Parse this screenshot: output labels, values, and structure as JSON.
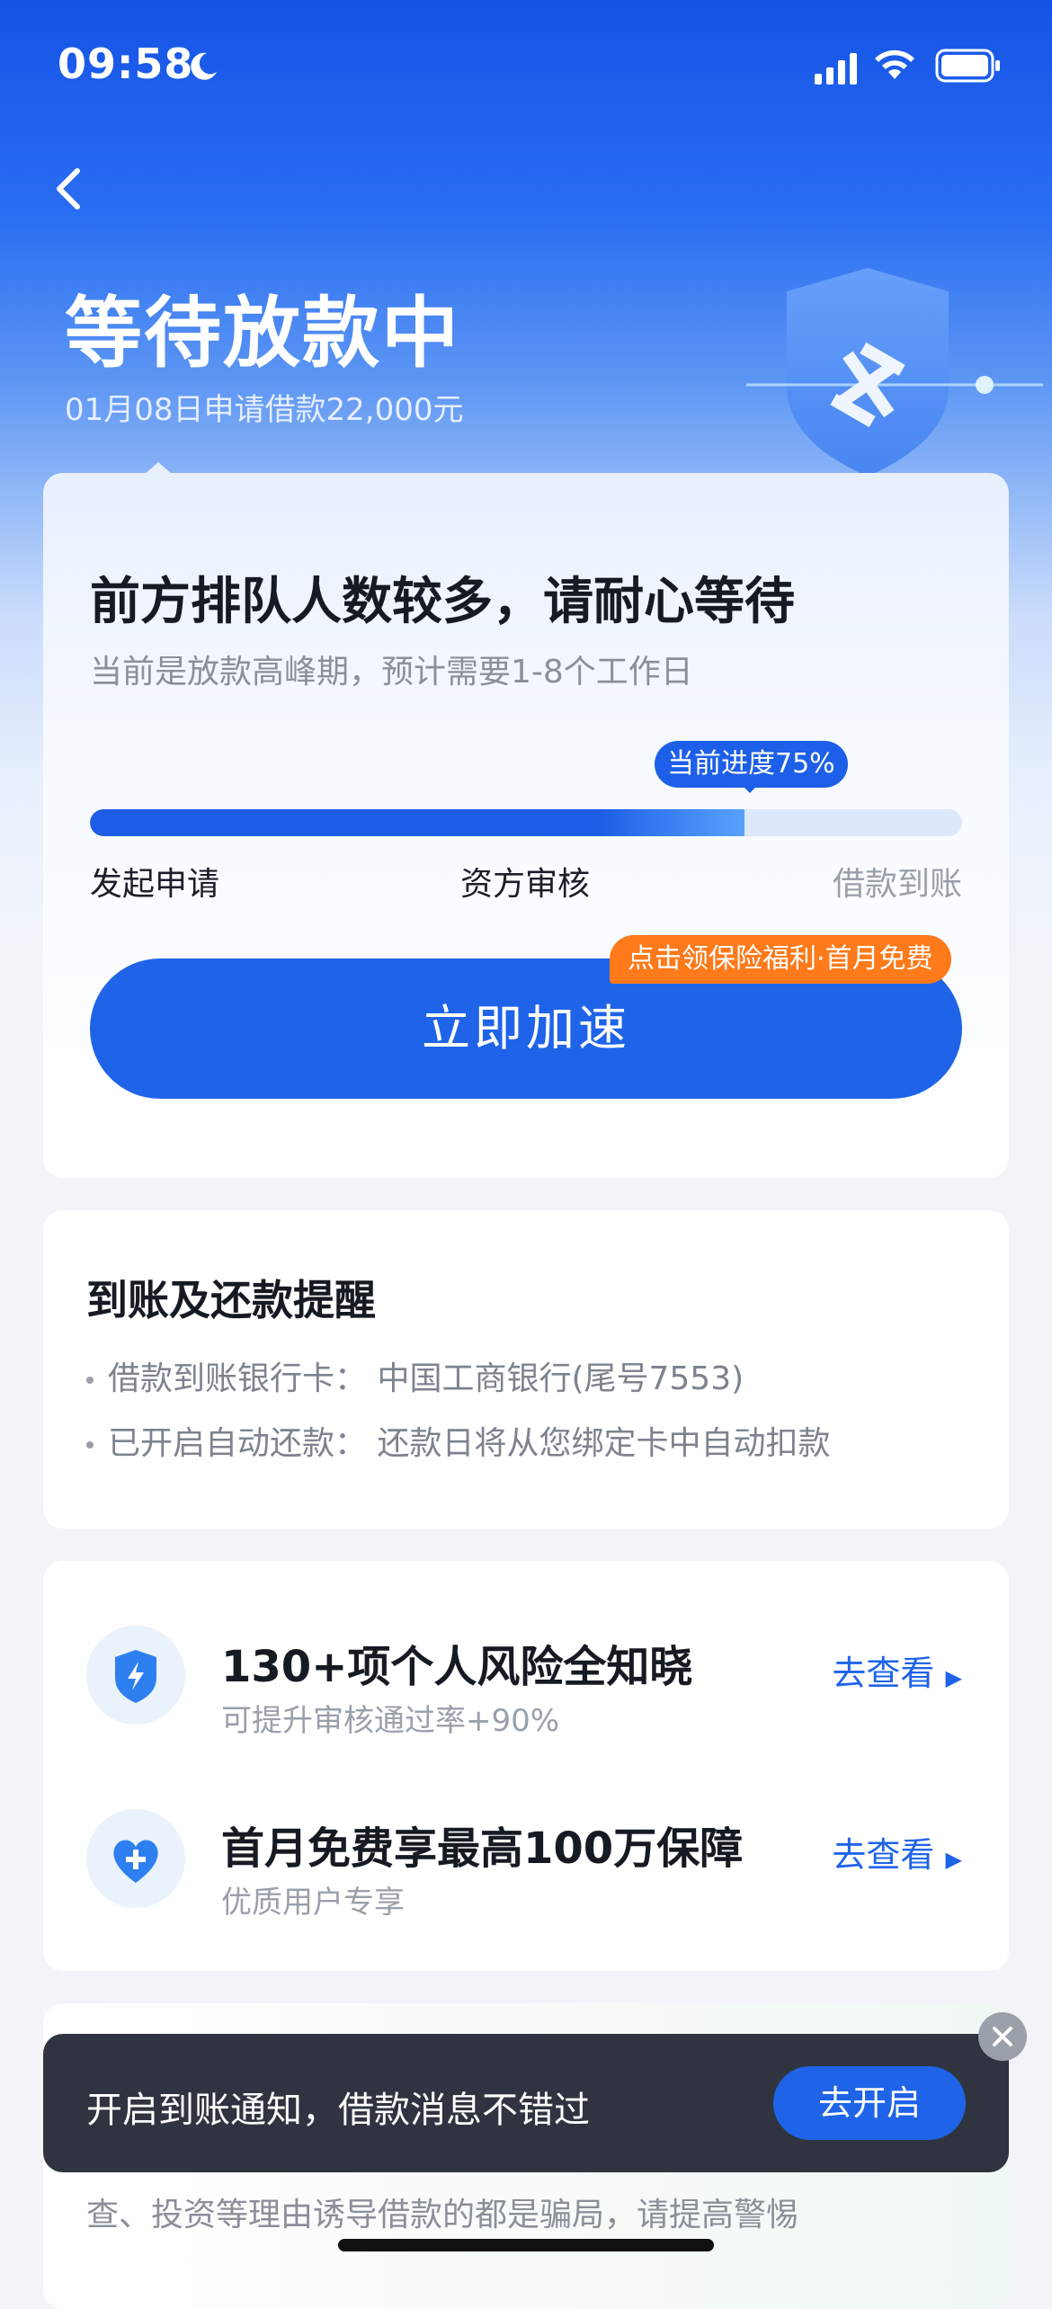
{
  "status_bar": {
    "time": "09:58"
  },
  "header": {
    "title": "等待放款中",
    "subtitle": "01月08日申请借款22,000元"
  },
  "progress_card": {
    "heading": "前方排队人数较多，请耐心等待",
    "subheading": "当前是放款高峰期，预计需要1-8个工作日",
    "progress_label": "当前进度75%",
    "progress_fraction": 0.75,
    "steps": [
      "发起申请",
      "资方审核",
      "借款到账"
    ],
    "accelerate_button": "立即加速",
    "promo_badge": "点击领保险福利·首月免费"
  },
  "reminder_card": {
    "heading": "到账及还款提醒",
    "items": [
      "借款到账银行卡：  中国工商银行(尾号7553)",
      "已开启自动还款：  还款日将从您绑定卡中自动扣款"
    ]
  },
  "services_card": {
    "rows": [
      {
        "title": "130+项个人风险全知晓",
        "subtitle": "可提升审核通过率+90%",
        "link": "去查看",
        "icon": "shield-lightning-icon"
      },
      {
        "title": "首月免费享最高100万保障",
        "subtitle": "优质用户专享",
        "link": "去查看",
        "icon": "heart-plus-icon"
      }
    ]
  },
  "warning_card": {
    "text": "查、投资等理由诱导借款的都是骗局，请提高警惕"
  },
  "toast": {
    "message": "开启到账通知，借款消息不错过",
    "button": "去开启"
  },
  "colors": {
    "primary": "#1f64e8",
    "promo": "#ff7a1a",
    "toast_bg": "#2f3440"
  }
}
